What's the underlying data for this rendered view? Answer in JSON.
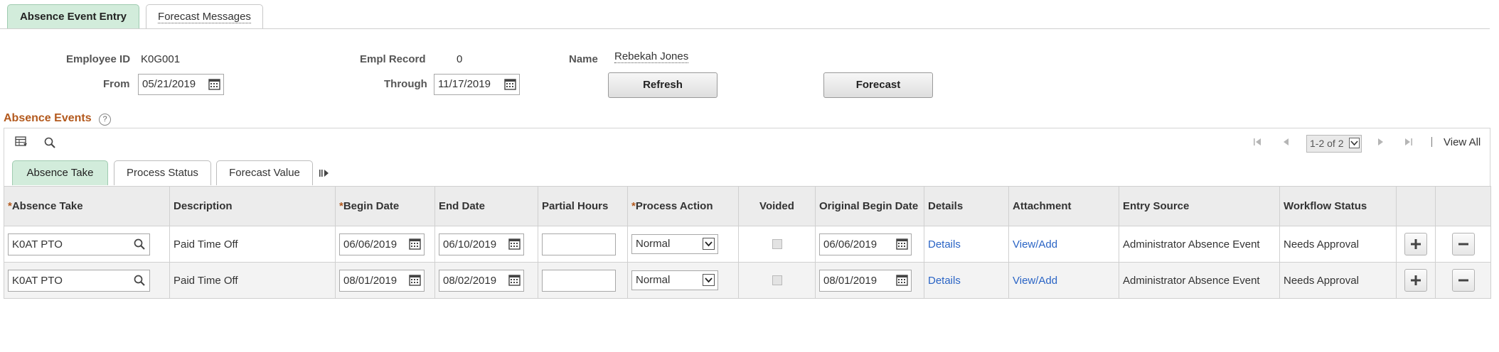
{
  "page_tabs": [
    {
      "label": "Absence Event Entry",
      "active": true
    },
    {
      "label": "Forecast Messages",
      "active": false
    }
  ],
  "header": {
    "employee_id_label": "Employee ID",
    "employee_id": "K0G001",
    "empl_record_label": "Empl Record",
    "empl_record": "0",
    "name_label": "Name",
    "name": "Rebekah Jones",
    "from_label": "From",
    "from_date": "05/21/2019",
    "through_label": "Through",
    "through_date": "11/17/2019",
    "refresh_button": "Refresh",
    "forecast_button": "Forecast"
  },
  "section": {
    "title": "Absence Events",
    "help": "?"
  },
  "pager": {
    "range": "1-2 of 2",
    "view_all": "View All"
  },
  "grid_tabs": [
    {
      "label": "Absence Take",
      "active": true
    },
    {
      "label": "Process Status",
      "active": false
    },
    {
      "label": "Forecast Value",
      "active": false
    }
  ],
  "columns": [
    {
      "label": "Absence Take",
      "required": true
    },
    {
      "label": "Description",
      "required": false
    },
    {
      "label": "Begin Date",
      "required": true
    },
    {
      "label": "End Date",
      "required": false
    },
    {
      "label": "Partial Hours",
      "required": false
    },
    {
      "label": "Process Action",
      "required": true
    },
    {
      "label": "Voided",
      "required": false
    },
    {
      "label": "Original Begin Date",
      "required": false
    },
    {
      "label": "Details",
      "required": false
    },
    {
      "label": "Attachment",
      "required": false
    },
    {
      "label": "Entry Source",
      "required": false
    },
    {
      "label": "Workflow Status",
      "required": false
    }
  ],
  "required_marker": "*",
  "rows": [
    {
      "absence_take": "K0AT PTO",
      "description": "Paid Time Off",
      "begin_date": "06/06/2019",
      "end_date": "06/10/2019",
      "partial_hours": "",
      "process_action": "Normal",
      "voided": false,
      "original_begin_date": "06/06/2019",
      "details": "Details",
      "attachment": "View/Add",
      "entry_source": "Administrator Absence Event",
      "workflow_status": "Needs Approval"
    },
    {
      "absence_take": "K0AT PTO",
      "description": "Paid Time Off",
      "begin_date": "08/01/2019",
      "end_date": "08/02/2019",
      "partial_hours": "",
      "process_action": "Normal",
      "voided": false,
      "original_begin_date": "08/01/2019",
      "details": "Details",
      "attachment": "View/Add",
      "entry_source": "Administrator Absence Event",
      "workflow_status": "Needs Approval"
    }
  ],
  "colors": {
    "active_tab": "#d2ecdb",
    "section_title": "#b3591d",
    "link": "#2a64c5",
    "header_bg": "#ececec"
  }
}
